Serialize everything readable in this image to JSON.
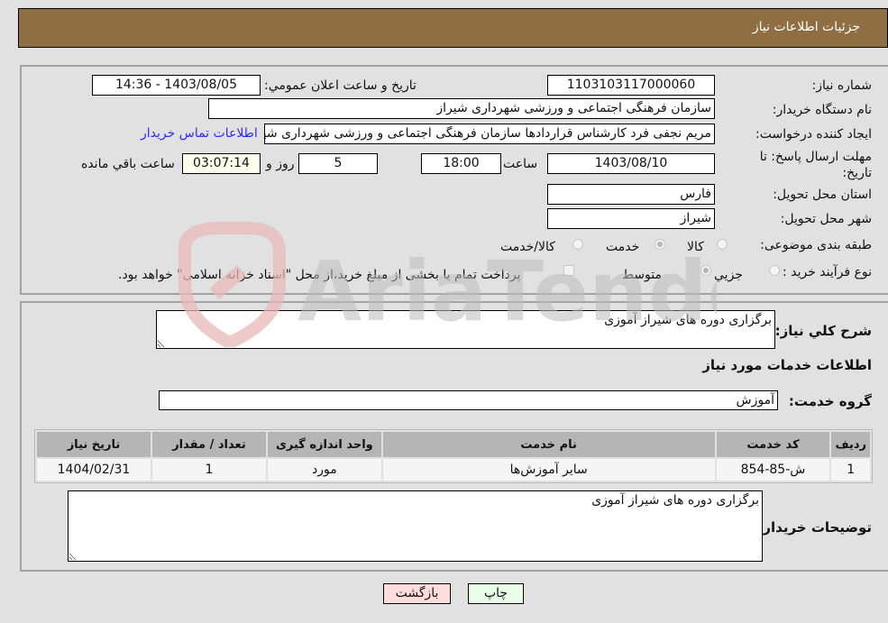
{
  "header": {
    "title": "جزئيات اطلاعات نياز"
  },
  "details": {
    "need_number_label": "شماره نياز:",
    "need_number": "1103103117000060",
    "announce_label": "تاريخ و ساعت اعلان عمومي:",
    "announce_value": "1403/08/05 - 14:36",
    "buyer_org_label": "نام دستگاه خريدار:",
    "buyer_org": "سازمان فرهنگی اجتماعی و ورزشی شهرداری شیراز",
    "creator_label": "ايجاد کننده درخواست:",
    "creator": "مریم نجفی فرد کارشناس قراردادها سازمان فرهنگی اجتماعی و ورزشی شهرداری شیراز",
    "contact_link": "اطلاعات تماس خريدار",
    "deadline_label": "مهلت ارسال پاسخ: تا تاريخ:",
    "deadline_date": "1403/08/10",
    "time_label": "ساعت",
    "deadline_time": "18:00",
    "days_value": "5",
    "days_label": "روز و",
    "remaining_value": "03:07:14",
    "remaining_label": "ساعت باقي مانده",
    "province_label": "استان محل تحويل:",
    "province": "فارس",
    "city_label": "شهر محل تحويل:",
    "city": "شیراز",
    "category_label": "طبقه بندی موضوعی:",
    "category_options": [
      {
        "label": "کالا",
        "selected": false
      },
      {
        "label": "خدمت",
        "selected": true
      },
      {
        "label": "کالا/خدمت",
        "selected": false
      }
    ],
    "process_label": "نوع فرآيند خريد :",
    "process_options": [
      {
        "label": "جزيي",
        "selected": false
      },
      {
        "label": "متوسط",
        "selected": true
      }
    ],
    "treasury_checkbox_label": "پرداخت تمام يا بخشی از مبلغ خريد،از محل \"اسناد خزانه اسلامی\" خواهد بود.",
    "treasury_checked": false
  },
  "services": {
    "description_label": "شرح کلي نياز:",
    "description": "برگزاری دوره های شیراز آموزی",
    "section_title": "اطلاعات خدمات مورد نياز",
    "group_label": "گروه خدمت:",
    "group_value": "آموزش",
    "table": {
      "columns": [
        "رديف",
        "کد خدمت",
        "نام خدمت",
        "واحد اندازه گيری",
        "تعداد / مقدار",
        "تاريخ نياز"
      ],
      "rows": [
        [
          "1",
          "ش-85-854",
          "سایر آموزش‌ها",
          "مورد",
          "1",
          "1404/02/31"
        ]
      ]
    },
    "buyer_notes_label": "توضيحات خريدار:",
    "buyer_notes": "برگزاری دوره های شیراز آموزی"
  },
  "buttons": {
    "print": "چاپ",
    "back": "بازگشت"
  },
  "watermark": {
    "text": "AriaTender.neT"
  },
  "colors": {
    "header_bg": "#8e6e42",
    "print_bg": "#eaffea",
    "back_bg": "#ffdddd",
    "link": "#2a2aff"
  }
}
